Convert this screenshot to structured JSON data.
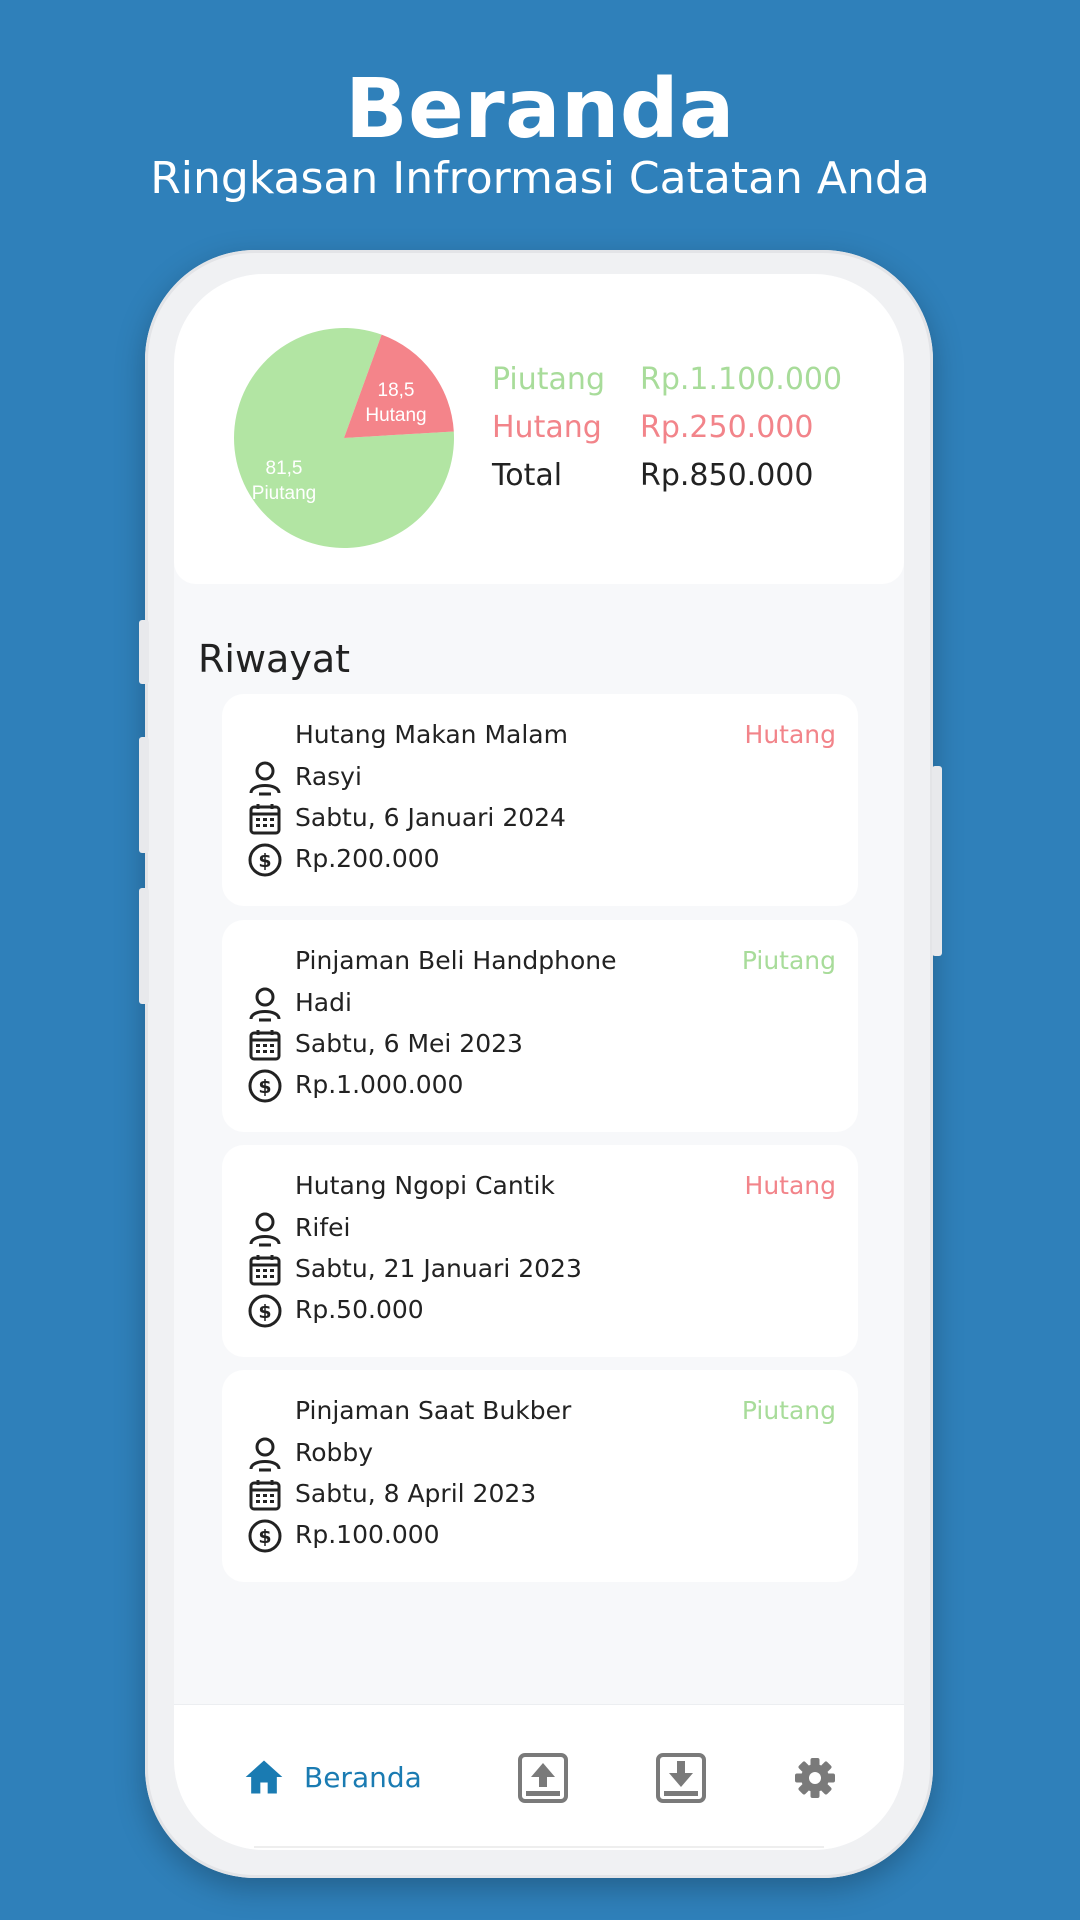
{
  "header": {
    "title": "Beranda",
    "subtitle": "Ringkasan Infrormasi Catatan Anda"
  },
  "colors": {
    "background": "#2f80ba",
    "piutang": "#a8dc9a",
    "hutang": "#f2848a",
    "accent": "#1a7bb2"
  },
  "summary": {
    "chart_data": {
      "type": "pie",
      "slices": [
        {
          "name": "Piutang",
          "value": 81.5,
          "label_value": "81,5",
          "label_name": "Piutang",
          "color": "#b2e5a3"
        },
        {
          "name": "Hutang",
          "value": 18.5,
          "label_value": "18,5",
          "label_name": "Hutang",
          "color": "#f4848a"
        }
      ]
    },
    "legend": [
      {
        "label": "Piutang",
        "value": "Rp.1.100.000",
        "tone": "green"
      },
      {
        "label": "Hutang",
        "value": "Rp.250.000",
        "tone": "red"
      },
      {
        "label": "Total",
        "value": "Rp.850.000",
        "tone": "dark"
      }
    ]
  },
  "history": {
    "title": "Riwayat",
    "items": [
      {
        "title": "Hutang Makan Malam",
        "type": "Hutang",
        "person": "Rasyi",
        "date": "Sabtu, 6 Januari 2024",
        "amount": "Rp.200.000"
      },
      {
        "title": "Pinjaman Beli Handphone",
        "type": "Piutang",
        "person": "Hadi",
        "date": "Sabtu, 6 Mei 2023",
        "amount": "Rp.1.000.000"
      },
      {
        "title": "Hutang Ngopi Cantik",
        "type": "Hutang",
        "person": "Rifei",
        "date": "Sabtu, 21 Januari 2023",
        "amount": "Rp.50.000"
      },
      {
        "title": "Pinjaman Saat Bukber",
        "type": "Piutang",
        "person": "Robby",
        "date": "Sabtu, 8 April 2023",
        "amount": "Rp.100.000"
      }
    ]
  },
  "nav": {
    "home_label": "Beranda",
    "items": [
      {
        "icon": "home-icon",
        "active": true
      },
      {
        "icon": "upload-icon",
        "active": false
      },
      {
        "icon": "download-icon",
        "active": false
      },
      {
        "icon": "gear-icon",
        "active": false
      }
    ]
  }
}
